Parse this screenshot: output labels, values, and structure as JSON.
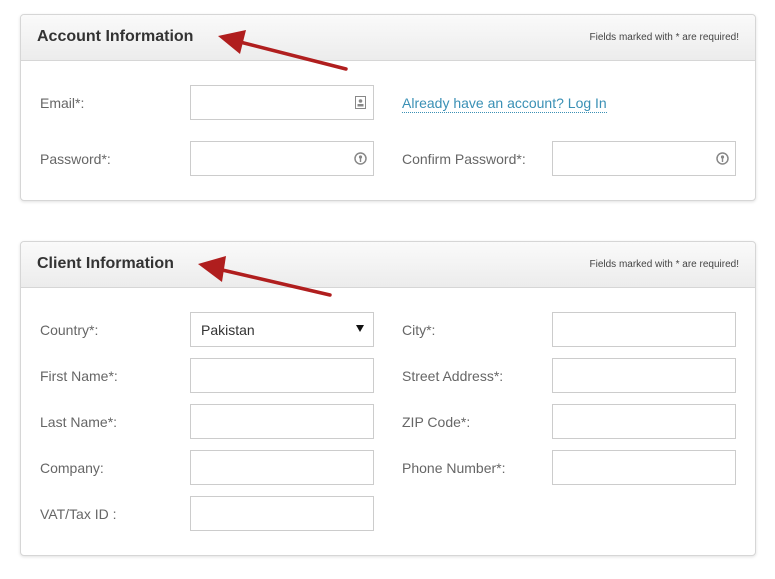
{
  "account_panel": {
    "title": "Account Information",
    "required_note": "Fields marked with * are required!",
    "email_label": "Email*:",
    "email_value": "",
    "login_link": "Already have an account? Log In",
    "password_label": "Password*:",
    "password_value": "",
    "confirm_password_label": "Confirm Password*:",
    "confirm_password_value": "",
    "email_icon": "contact-card-icon",
    "password_icon": "password-key-icon"
  },
  "client_panel": {
    "title": "Client Information",
    "required_note": "Fields marked with * are required!",
    "country_label": "Country*:",
    "country_selected": "Pakistan",
    "first_name_label": "First Name*:",
    "last_name_label": "Last Name*:",
    "company_label": "Company:",
    "vat_label": "VAT/Tax ID :",
    "city_label": "City*:",
    "street_label": "Street Address*:",
    "zip_label": "ZIP Code*:",
    "phone_label": "Phone Number*:",
    "first_name_value": "",
    "last_name_value": "",
    "company_value": "",
    "vat_value": "",
    "city_value": "",
    "street_value": "",
    "zip_value": "",
    "phone_value": ""
  },
  "colors": {
    "link": "#3a90b5",
    "arrow": "#b01e1e",
    "header_bg": "#efefef",
    "border": "#cccccc"
  }
}
